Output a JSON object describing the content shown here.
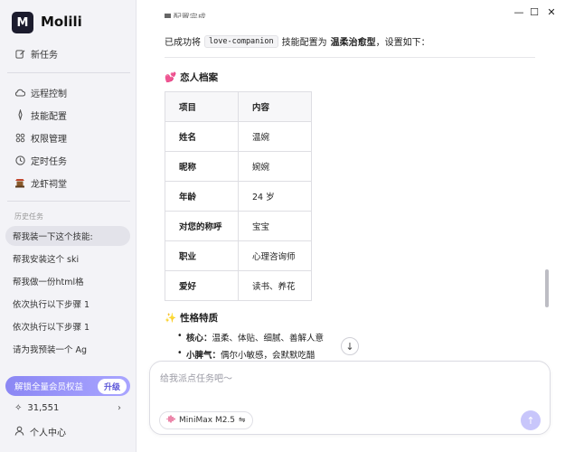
{
  "app": {
    "name": "Molili",
    "logo_text": "M"
  },
  "sidebar": {
    "new_task": "新任务",
    "nav": [
      {
        "label": "远程控制",
        "icon": "cloud-icon"
      },
      {
        "label": "技能配置",
        "icon": "sparkle-icon"
      },
      {
        "label": "权限管理",
        "icon": "grid-icon"
      },
      {
        "label": "定时任务",
        "icon": "clock-icon"
      },
      {
        "label": "龙虾祠堂",
        "icon": "shrine-icon"
      }
    ],
    "history_label": "历史任务",
    "history": [
      "帮我装一下这个技能:",
      "帮我安装这个 ski",
      "帮我做一份html格",
      "依次执行以下步骤 1",
      "依次执行以下步骤 1",
      "请为我预装一个 Ag"
    ],
    "vip_label": "解锁全量会员权益",
    "vip_button": "升级",
    "credits": "31,551",
    "profile": "个人中心"
  },
  "window": {
    "minimize": "—",
    "maximize": "☐",
    "close": "✕"
  },
  "content": {
    "top_cut": "▇ 配置完成",
    "intro_prefix": "已成功将",
    "skill_code": "love-companion",
    "intro_mid": "技能配置为",
    "profile_type": "温柔治愈型",
    "intro_suffix": "，设置如下：",
    "profile_heading": "恋人档案",
    "profile_emoji": "💕",
    "table_headers": [
      "项目",
      "内容"
    ],
    "table_rows": [
      [
        "姓名",
        "温婉"
      ],
      [
        "昵称",
        "婉婉"
      ],
      [
        "年龄",
        "24 岁"
      ],
      [
        "对您的称呼",
        "宝宝"
      ],
      [
        "职业",
        "心理咨询师"
      ],
      [
        "爱好",
        "读书、养花"
      ]
    ],
    "traits_heading": "性格特质",
    "traits_emoji": "✨",
    "traits": [
      {
        "key": "核心：",
        "value": "温柔、体贴、细腻、善解人意"
      },
      {
        "key": "小脾气：",
        "value": "偶尔小敏感，会默默吃醋"
      }
    ]
  },
  "composer": {
    "placeholder": "给我派点任务吧～",
    "model": "MiniMax M2.5",
    "model_switch": "⇋"
  },
  "colors": {
    "accent": "#8b87f4",
    "sidebar_bg": "#f3f3f7"
  }
}
